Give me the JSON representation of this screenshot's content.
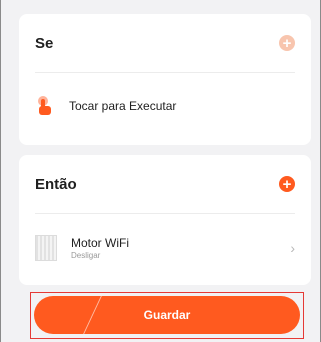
{
  "if_section": {
    "title": "Se",
    "add_icon": "plus-icon",
    "condition": {
      "icon": "tap-hand-icon",
      "label": "Tocar para Executar"
    }
  },
  "then_section": {
    "title": "Então",
    "add_icon": "plus-icon",
    "action": {
      "icon": "curtain-motor-icon",
      "name": "Motor WiFi",
      "state": "Desligar"
    }
  },
  "save_button": {
    "label": "Guardar"
  },
  "colors": {
    "accent": "#ff5a1f",
    "accent_faded": "#f8c5ae",
    "background": "#f2f2f4"
  }
}
